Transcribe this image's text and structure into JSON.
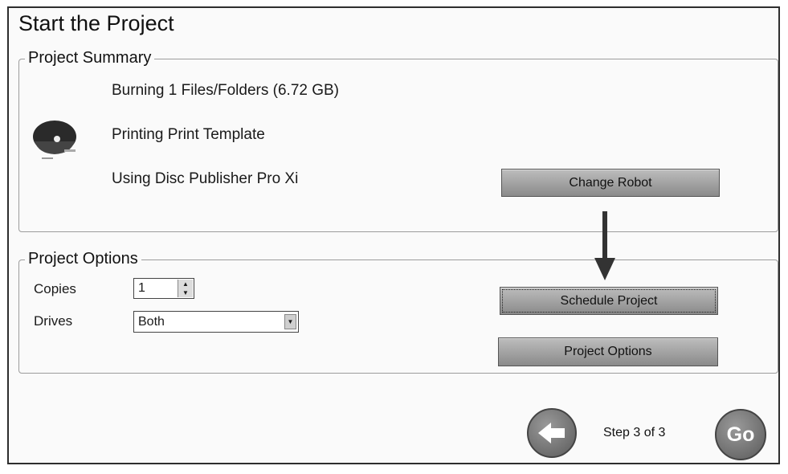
{
  "window": {
    "title": "Start the Project"
  },
  "summary": {
    "legend": "Project Summary",
    "lines": [
      "Burning 1 Files/Folders (6.72 GB)",
      "Printing Print Template",
      "Using Disc Publisher Pro Xi"
    ],
    "change_robot_label": "Change Robot",
    "icon": "disc-icon"
  },
  "options": {
    "legend": "Project Options",
    "copies_label": "Copies",
    "copies_value": "1",
    "drives_label": "Drives",
    "drives_value": "Both",
    "schedule_label": "Schedule Project",
    "project_options_label": "Project Options"
  },
  "footer": {
    "step_text": "Step 3 of 3",
    "go_label": "Go",
    "back_icon": "back-arrow-icon"
  },
  "annotation": {
    "arrow_icon": "down-arrow-icon"
  }
}
